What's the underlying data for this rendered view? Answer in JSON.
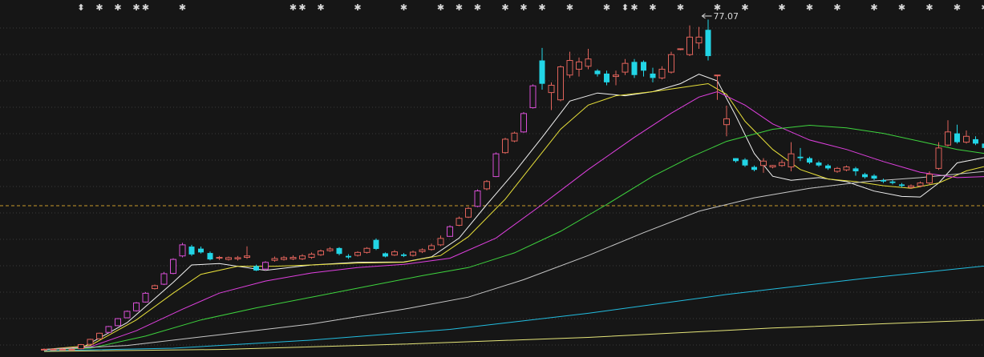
{
  "chart_data": {
    "type": "candlestick",
    "title": "",
    "xlabel": "",
    "ylabel": "",
    "ylim": [
      0,
      87
    ],
    "grid": true,
    "legend": "none",
    "colors": {
      "background": "#161616",
      "grid": "#3a3a3a",
      "up": "#e0635b",
      "down": "#22d5e6",
      "reference_line": "#c89a2a",
      "marker": "#d8d8d8",
      "annotation": "#d8d8d8",
      "limit_up_candle": "#d84fd6"
    },
    "reference_price": 37.9,
    "candles": [
      [
        1,
        1.0,
        1.0,
        0.7,
        1.3
      ],
      [
        2,
        1.0,
        1.0,
        0.7,
        1.3
      ],
      [
        3,
        1.0,
        1.0,
        0.7,
        1.3
      ],
      [
        4,
        1.0,
        1.0,
        0.7,
        1.3
      ],
      [
        5,
        1.2,
        2.6,
        1.0,
        2.8
      ],
      [
        6,
        2.7,
        4.4,
        2.5,
        4.6
      ],
      [
        7,
        4.6,
        6.5,
        4.4,
        6.7
      ],
      [
        8,
        6.8,
        8.8,
        6.6,
        9.0
      ],
      [
        9,
        9.1,
        11.5,
        8.9,
        11.7
      ],
      [
        10,
        11.8,
        14.0,
        11.6,
        14.3
      ],
      [
        11,
        14.2,
        16.9,
        13.9,
        17.2
      ],
      [
        12,
        17.2,
        20.2,
        17.0,
        20.6
      ],
      [
        13,
        21.8,
        22.8,
        21.5,
        23.2
      ],
      [
        14,
        23.3,
        26.9,
        23.0,
        27.5
      ],
      [
        15,
        27.0,
        31.8,
        26.7,
        32.2
      ],
      [
        16,
        33.0,
        36.8,
        32.5,
        37.5
      ],
      [
        17,
        36.2,
        33.5,
        33.0,
        36.8
      ],
      [
        18,
        35.5,
        34.2,
        33.8,
        36.2
      ],
      [
        19,
        34.0,
        31.8,
        31.5,
        34.5
      ],
      [
        20,
        32.3,
        32.5,
        31.6,
        33.0
      ],
      [
        21,
        31.8,
        32.4,
        31.4,
        32.8
      ],
      [
        22,
        32.0,
        32.4,
        31.4,
        33.0
      ],
      [
        23,
        32.5,
        33.0,
        32.0,
        36.3
      ],
      [
        24,
        29.5,
        28.0,
        27.8,
        30.0
      ],
      [
        25,
        28.5,
        30.8,
        28.0,
        31.2
      ],
      [
        26,
        31.5,
        32.1,
        31.0,
        32.8
      ],
      [
        27,
        31.8,
        32.4,
        31.4,
        33.0
      ],
      [
        28,
        32.0,
        32.5,
        31.6,
        33.2
      ],
      [
        29,
        32.0,
        33.0,
        31.6,
        33.6
      ],
      [
        30,
        32.5,
        33.6,
        32.0,
        34.2
      ],
      [
        31,
        33.4,
        34.7,
        33.0,
        35.2
      ],
      [
        32,
        34.8,
        35.4,
        34.4,
        36.0
      ],
      [
        33,
        35.7,
        33.7,
        33.2,
        36.0
      ],
      [
        34,
        33.0,
        32.5,
        32.0,
        33.6
      ],
      [
        35,
        33.2,
        34.2,
        32.8,
        34.6
      ],
      [
        36,
        34.2,
        35.6,
        33.8,
        36.0
      ],
      [
        37,
        38.5,
        35.4,
        35.0,
        39.0
      ],
      [
        38,
        33.9,
        32.8,
        32.5,
        34.2
      ],
      [
        39,
        33.3,
        34.4,
        33.0,
        35.0
      ],
      [
        40,
        33.5,
        33.0,
        32.6,
        34.0
      ],
      [
        41,
        33.2,
        34.3,
        32.8,
        34.8
      ],
      [
        42,
        34.5,
        35.1,
        34.0,
        35.6
      ],
      [
        43,
        35.2,
        36.5,
        34.8,
        37.2
      ],
      [
        44,
        36.8,
        39.0,
        36.4,
        40.0
      ],
      [
        45,
        39.7,
        43.0,
        39.5,
        43.5
      ],
      [
        46,
        43.5,
        45.9,
        43.2,
        46.5
      ],
      [
        47,
        46.3,
        49.3,
        46.0,
        49.8
      ],
      [
        48,
        50.0,
        55.3,
        49.7,
        55.8
      ],
      [
        49,
        56.0,
        58.5,
        55.5,
        59.0
      ],
      [
        50,
        60.2,
        68.0,
        60.0,
        68.5
      ],
      [
        51,
        68.4,
        73.0,
        68.0,
        73.5
      ],
      [
        52,
        72.4,
        75.1,
        72.0,
        75.6
      ],
      [
        53,
        75.5,
        81.8,
        75.2,
        82.3
      ],
      [
        54,
        83.8,
        91.3,
        83.5,
        91.8
      ],
      [
        55,
        100.0,
        92.0,
        90.0,
        104.3
      ],
      [
        56,
        89.0,
        91.5,
        83.0,
        92.5
      ],
      [
        57,
        86.5,
        97.8,
        86.0,
        98.3
      ],
      [
        58,
        95.0,
        100.0,
        94.0,
        103.0
      ],
      [
        59,
        97.0,
        99.5,
        94.5,
        101.0
      ],
      [
        60,
        98.0,
        100.5,
        97.0,
        104.0
      ],
      [
        61,
        96.5,
        95.3,
        94.5,
        97.0
      ],
      [
        62,
        95.5,
        92.5,
        91.5,
        96.5
      ],
      [
        63,
        94.5,
        95.0,
        91.5,
        96.5
      ],
      [
        64,
        96.0,
        99.0,
        95.0,
        100.5
      ],
      [
        65,
        99.5,
        95.0,
        94.0,
        100.5
      ],
      [
        66,
        99.5,
        96.5,
        94.5,
        100.0
      ],
      [
        67,
        95.5,
        94.0,
        92.5,
        97.5
      ],
      [
        68,
        94.0,
        97.0,
        93.5,
        98.0
      ],
      [
        69,
        96.0,
        102.0,
        95.5,
        103.0
      ],
      [
        70,
        104.0,
        104.0,
        103.5,
        104.0
      ],
      [
        71,
        102.0,
        108.0,
        101.5,
        112.0
      ],
      [
        72,
        106.0,
        108.0,
        104.0,
        111.5
      ],
      [
        73,
        110.5,
        101.5,
        100.0,
        114.0
      ],
      [
        74,
        95.0,
        95.0,
        86.5,
        95.0
      ],
      [
        75,
        78.0,
        80.0,
        74.0,
        84.5
      ],
      [
        76,
        66.5,
        65.5,
        65.0,
        66.5
      ],
      [
        77,
        66.0,
        64.0,
        63.5,
        66.5
      ],
      [
        78,
        63.5,
        62.5,
        62.0,
        64.0
      ],
      [
        79,
        64.0,
        65.5,
        61.5,
        66.5
      ],
      [
        80,
        63.5,
        64.0,
        63.0,
        64.2
      ],
      [
        81,
        64.0,
        65.0,
        63.5,
        66.0
      ],
      [
        82,
        63.5,
        68.0,
        62.0,
        72.0
      ],
      [
        83,
        67.0,
        66.5,
        65.5,
        70.0
      ],
      [
        84,
        66.5,
        65.0,
        64.5,
        67.0
      ],
      [
        85,
        65.0,
        64.0,
        63.5,
        65.5
      ],
      [
        86,
        64.0,
        63.0,
        62.5,
        64.5
      ],
      [
        87,
        62.0,
        63.0,
        61.5,
        63.5
      ],
      [
        88,
        62.5,
        63.5,
        62.0,
        64.0
      ],
      [
        89,
        63.0,
        62.0,
        60.5,
        63.5
      ],
      [
        90,
        61.0,
        60.0,
        59.5,
        61.5
      ],
      [
        91,
        60.5,
        59.5,
        59.0,
        61.0
      ],
      [
        92,
        59.0,
        58.5,
        58.0,
        59.5
      ],
      [
        93,
        58.5,
        58.0,
        57.5,
        59.0
      ],
      [
        94,
        57.5,
        57.0,
        56.5,
        58.0
      ],
      [
        95,
        56.5,
        57.0,
        56.0,
        57.5
      ],
      [
        96,
        57.0,
        58.0,
        56.5,
        58.5
      ],
      [
        97,
        58.0,
        61.0,
        57.5,
        62.0
      ],
      [
        98,
        63.0,
        70.0,
        62.5,
        72.0
      ],
      [
        99,
        71.0,
        75.5,
        70.5,
        79.5
      ],
      [
        100,
        75.0,
        72.0,
        71.5,
        78.0
      ],
      [
        101,
        72.0,
        74.0,
        71.5,
        76.0
      ],
      [
        102,
        73.0,
        71.5,
        71.0,
        74.0
      ],
      [
        103,
        71.5,
        70.0,
        69.5,
        72.5
      ],
      [
        104,
        70.0,
        69.5,
        69.0,
        71.0
      ],
      [
        105,
        69.5,
        70.5,
        69.0,
        71.5
      ],
      [
        106,
        70.5,
        70.0,
        69.5,
        71.0
      ],
      [
        107,
        70.0,
        70.5,
        69.5,
        72.5
      ]
    ],
    "ma_lines": [
      {
        "color": "#f2f2f2",
        "points": [
          [
            1,
            1.0
          ],
          [
            5,
            1.5
          ],
          [
            10,
            11.0
          ],
          [
            15,
            26.0
          ],
          [
            17,
            32.5
          ],
          [
            20,
            33.0
          ],
          [
            25,
            30.5
          ],
          [
            30,
            32.5
          ],
          [
            35,
            33.5
          ],
          [
            40,
            33.6
          ],
          [
            43,
            35.5
          ],
          [
            46,
            42.5
          ],
          [
            49,
            55.0
          ],
          [
            52,
            67.0
          ],
          [
            55,
            80.0
          ],
          [
            58,
            93.5
          ],
          [
            61,
            96.5
          ],
          [
            64,
            95.5
          ],
          [
            67,
            97.0
          ],
          [
            70,
            100.0
          ],
          [
            72,
            103.5
          ],
          [
            74,
            101.0
          ],
          [
            76,
            88.0
          ],
          [
            78,
            74.0
          ],
          [
            80,
            65.5
          ],
          [
            82,
            64.0
          ],
          [
            85,
            65.0
          ],
          [
            88,
            63.5
          ],
          [
            91,
            60.0
          ],
          [
            94,
            58.0
          ],
          [
            96,
            57.8
          ],
          [
            98,
            63.0
          ],
          [
            100,
            70.5
          ],
          [
            103,
            72.5
          ],
          [
            106,
            70.5
          ],
          [
            107,
            70.0
          ]
        ]
      },
      {
        "color": "#e8e03a",
        "points": [
          [
            1,
            1.0
          ],
          [
            6,
            2.5
          ],
          [
            11,
            12.0
          ],
          [
            15,
            22.0
          ],
          [
            18,
            29.0
          ],
          [
            22,
            32.0
          ],
          [
            26,
            32.0
          ],
          [
            30,
            32.5
          ],
          [
            35,
            33.2
          ],
          [
            40,
            33.5
          ],
          [
            44,
            36.0
          ],
          [
            47,
            43.0
          ],
          [
            51,
            57.0
          ],
          [
            54,
            70.0
          ],
          [
            57,
            83.0
          ],
          [
            60,
            92.0
          ],
          [
            63,
            95.5
          ],
          [
            67,
            97.0
          ],
          [
            70,
            98.5
          ],
          [
            73,
            100.0
          ],
          [
            75,
            96.0
          ],
          [
            77,
            86.0
          ],
          [
            80,
            75.5
          ],
          [
            83,
            68.0
          ],
          [
            86,
            64.5
          ],
          [
            89,
            63.5
          ],
          [
            92,
            62.0
          ],
          [
            95,
            61.0
          ],
          [
            98,
            63.0
          ],
          [
            101,
            67.5
          ],
          [
            104,
            70.0
          ],
          [
            107,
            71.5
          ]
        ]
      },
      {
        "color": "#e040e0",
        "points": [
          [
            1,
            1.0
          ],
          [
            6,
            2.0
          ],
          [
            11,
            8.0
          ],
          [
            16,
            16.0
          ],
          [
            20,
            22.0
          ],
          [
            25,
            26.5
          ],
          [
            30,
            29.5
          ],
          [
            35,
            31.5
          ],
          [
            40,
            32.7
          ],
          [
            45,
            35.0
          ],
          [
            50,
            42.5
          ],
          [
            55,
            55.0
          ],
          [
            60,
            68.0
          ],
          [
            65,
            80.0
          ],
          [
            69,
            89.0
          ],
          [
            72,
            95.0
          ],
          [
            74,
            97.0
          ],
          [
            77,
            92.0
          ],
          [
            80,
            85.0
          ],
          [
            84,
            79.0
          ],
          [
            88,
            75.5
          ],
          [
            92,
            71.0
          ],
          [
            96,
            67.0
          ],
          [
            100,
            65.0
          ],
          [
            104,
            65.5
          ],
          [
            107,
            66.0
          ]
        ]
      },
      {
        "color": "#3ed43e",
        "points": [
          [
            1,
            1.0
          ],
          [
            6,
            1.5
          ],
          [
            12,
            6.0
          ],
          [
            18,
            12.0
          ],
          [
            24,
            16.5
          ],
          [
            30,
            20.5
          ],
          [
            36,
            24.5
          ],
          [
            42,
            28.5
          ],
          [
            47,
            31.5
          ],
          [
            52,
            37.0
          ],
          [
            57,
            45.0
          ],
          [
            62,
            55.0
          ],
          [
            67,
            65.5
          ],
          [
            71,
            72.5
          ],
          [
            75,
            78.5
          ],
          [
            80,
            83.0
          ],
          [
            84,
            84.5
          ],
          [
            88,
            83.5
          ],
          [
            92,
            81.5
          ],
          [
            96,
            78.5
          ],
          [
            100,
            75.5
          ],
          [
            104,
            73.5
          ],
          [
            107,
            72.5
          ]
        ]
      },
      {
        "color": "#c8c8c8",
        "points": [
          [
            1,
            1.0
          ],
          [
            10,
            2.5
          ],
          [
            20,
            6.5
          ],
          [
            30,
            10.5
          ],
          [
            40,
            16.0
          ],
          [
            47,
            20.5
          ],
          [
            53,
            27.0
          ],
          [
            60,
            36.0
          ],
          [
            66,
            44.5
          ],
          [
            72,
            52.5
          ],
          [
            78,
            57.5
          ],
          [
            84,
            61.0
          ],
          [
            90,
            63.5
          ],
          [
            96,
            65.0
          ],
          [
            102,
            67.0
          ],
          [
            107,
            68.5
          ]
        ]
      },
      {
        "color": "#22bde0",
        "points": [
          [
            1,
            0.5
          ],
          [
            15,
            1.5
          ],
          [
            30,
            4.5
          ],
          [
            45,
            8.5
          ],
          [
            60,
            14.5
          ],
          [
            75,
            21.5
          ],
          [
            90,
            27.5
          ],
          [
            107,
            33.5
          ]
        ]
      },
      {
        "color": "#e6e67a",
        "points": [
          [
            1,
            0.3
          ],
          [
            20,
            1.0
          ],
          [
            40,
            3.0
          ],
          [
            60,
            5.5
          ],
          [
            80,
            9.0
          ],
          [
            95,
            11.0
          ],
          [
            107,
            12.5
          ]
        ]
      }
    ],
    "ma_scale": 0.695,
    "markers": {
      "double_arrow": [
        5,
        64
      ],
      "star": [
        7,
        9,
        11,
        12,
        16,
        28,
        29,
        31,
        35,
        40,
        44,
        46,
        48,
        51,
        53,
        55,
        58,
        62,
        65,
        67,
        70,
        74,
        77,
        81,
        84,
        87,
        91,
        94,
        97,
        100,
        103,
        106
      ],
      "symbol_double_arrow": "⬍",
      "symbol_star": "✱"
    },
    "annotation": {
      "x": 72,
      "price": 77.07,
      "text": "77.07"
    }
  }
}
